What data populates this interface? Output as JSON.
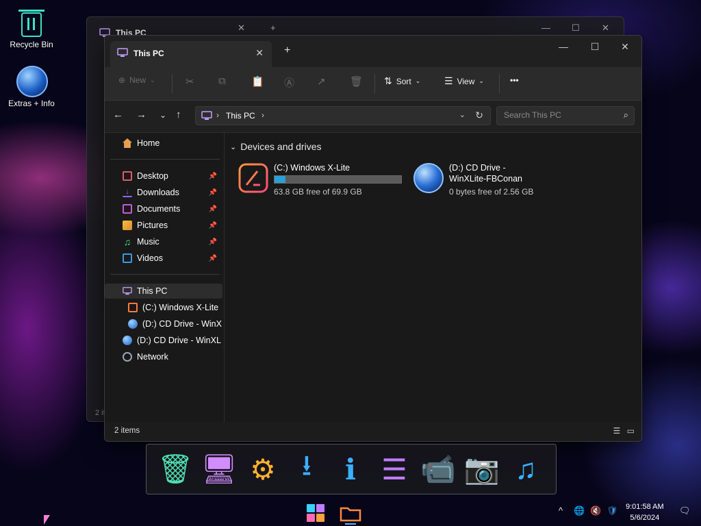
{
  "desktop": {
    "icons": [
      {
        "label": "Recycle Bin",
        "icon": "recycle-bin-icon"
      },
      {
        "label": "Extras + Info",
        "icon": "extras-orb-icon"
      }
    ]
  },
  "background_window": {
    "tab_title": "This PC",
    "status_text": "2 items"
  },
  "window": {
    "tab_title": "This PC",
    "new_tab_symbol": "+",
    "close_tab_symbol": "✕",
    "controls": {
      "minimize": "—",
      "maximize": "☐",
      "close": "✕"
    },
    "toolbar": {
      "new_label": "New",
      "sort_label": "Sort",
      "view_label": "View",
      "more_label": "•••"
    },
    "address": {
      "crumb": "This PC",
      "search_placeholder": "Search This PC"
    },
    "sidebar": {
      "home": "Home",
      "quick": [
        {
          "label": "Desktop",
          "color": "#e05a6e"
        },
        {
          "label": "Downloads",
          "color": "#8a6cf0"
        },
        {
          "label": "Documents",
          "color": "#c45ad8"
        },
        {
          "label": "Pictures",
          "color": "#f0c040"
        },
        {
          "label": "Music",
          "color": "#4ad88a"
        },
        {
          "label": "Videos",
          "color": "#3a9ae0"
        }
      ],
      "pin_symbol": "📌",
      "this_pc": "This PC",
      "drive_c": "(C:) Windows X-Lite",
      "drive_d_sub": "(D:) CD Drive - WinX",
      "drive_d": "(D:) CD Drive - WinXL",
      "network": "Network"
    },
    "content": {
      "group_title": "Devices and drives",
      "drives": [
        {
          "name": "(C:) Windows X-Lite",
          "free": "63.8 GB free of 69.9 GB",
          "used_fraction": 0.087
        },
        {
          "name": "(D:) CD Drive -",
          "name2": "WinXLite-FBConan",
          "free": "0 bytes free of 2.56 GB"
        }
      ]
    },
    "status": {
      "count": "2 items"
    }
  },
  "dock": {
    "items": [
      "recycle-bin-icon",
      "monitor-icon",
      "gear-icon",
      "download-icon",
      "info-icon",
      "list-icon",
      "video-camera-icon",
      "camera-icon",
      "music-icon"
    ]
  },
  "taskbar": {
    "time": "9:01:58 AM",
    "date": "5/6/2024"
  },
  "accent": "#2b9fd8"
}
